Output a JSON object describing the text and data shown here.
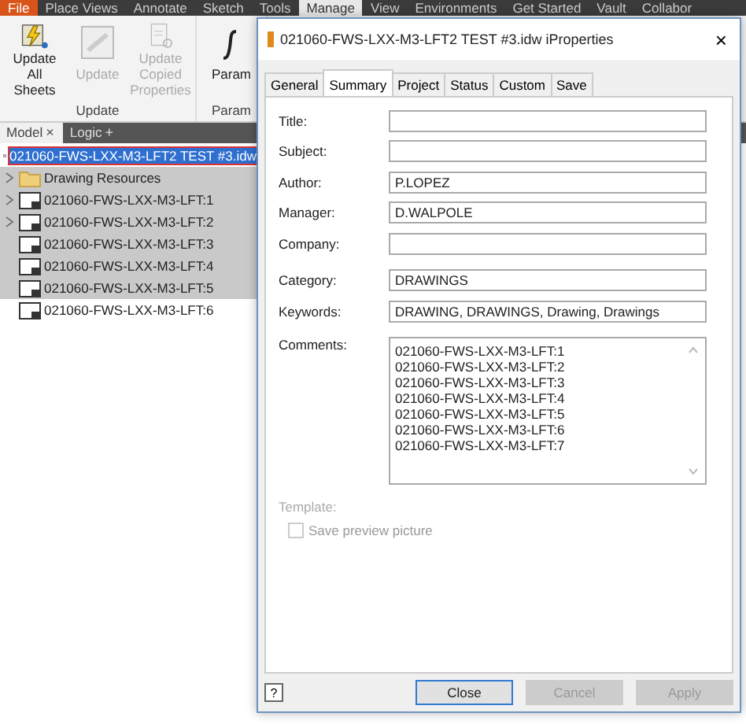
{
  "ribbon_tabs": [
    {
      "label": "File",
      "kind": "file",
      "selected": false
    },
    {
      "label": "Place Views",
      "kind": "tab",
      "selected": false
    },
    {
      "label": "Annotate",
      "kind": "tab",
      "selected": false
    },
    {
      "label": "Sketch",
      "kind": "tab",
      "selected": false
    },
    {
      "label": "Tools",
      "kind": "tab",
      "selected": false
    },
    {
      "label": "Manage",
      "kind": "tab",
      "selected": true
    },
    {
      "label": "View",
      "kind": "tab",
      "selected": false
    },
    {
      "label": "Environments",
      "kind": "tab",
      "selected": false
    },
    {
      "label": "Get Started",
      "kind": "tab",
      "selected": false
    },
    {
      "label": "Vault",
      "kind": "tab",
      "selected": false
    },
    {
      "label": "Collabor",
      "kind": "tab",
      "selected": false
    }
  ],
  "ribbon_panels": [
    {
      "title": "Update",
      "buttons": [
        {
          "label": "Update All Sheets",
          "disabled": false,
          "kind": "update-all"
        },
        {
          "label": "Update",
          "disabled": true,
          "kind": "update"
        },
        {
          "label": "Update Copied Properties",
          "disabled": true,
          "kind": "copied"
        }
      ]
    },
    {
      "title": "Param",
      "buttons": [
        {
          "label": "Param",
          "disabled": false,
          "kind": "param"
        }
      ]
    }
  ],
  "browser_tabs": [
    {
      "label": "Model",
      "selected": true,
      "action": "×"
    },
    {
      "label": "Logic",
      "selected": false,
      "action": "+"
    }
  ],
  "tree": {
    "label": "021060-FWS-LXX-M3-LFT2 TEST  #3.idw",
    "selected": true,
    "children": [
      {
        "label": "Drawing Resources",
        "kind": "folder",
        "highlighted": true,
        "expandable": true
      },
      {
        "label": "021060-FWS-LXX-M3-LFT:1",
        "kind": "sheet",
        "highlighted": true,
        "expandable": true
      },
      {
        "label": "021060-FWS-LXX-M3-LFT:2",
        "kind": "sheet",
        "highlighted": true,
        "expandable": true
      },
      {
        "label": "021060-FWS-LXX-M3-LFT:3",
        "kind": "sheet",
        "highlighted": true,
        "expandable": false
      },
      {
        "label": "021060-FWS-LXX-M3-LFT:4",
        "kind": "sheet",
        "highlighted": true,
        "expandable": false
      },
      {
        "label": "021060-FWS-LXX-M3-LFT:5",
        "kind": "sheet",
        "highlighted": true,
        "expandable": false
      },
      {
        "label": "021060-FWS-LXX-M3-LFT:6",
        "kind": "sheet",
        "highlighted": false,
        "expandable": false
      }
    ]
  },
  "dialog": {
    "title": "021060-FWS-LXX-M3-LFT2 TEST #3.idw iProperties",
    "close": "×",
    "tabs": [
      {
        "label": "General",
        "selected": false
      },
      {
        "label": "Summary",
        "selected": true
      },
      {
        "label": "Project",
        "selected": false
      },
      {
        "label": "Status",
        "selected": false
      },
      {
        "label": "Custom",
        "selected": false
      },
      {
        "label": "Save",
        "selected": false
      }
    ],
    "field_groups": [
      [
        {
          "label": "Title:"
        },
        {
          "label": "Subject:"
        },
        {
          "label": "Author:",
          "value": "P.LOPEZ"
        },
        {
          "label": "Manager:",
          "value": "D.WALPOLE"
        },
        {
          "label": "Company:"
        }
      ],
      [
        {
          "label": "Category:",
          "value": "DRAWINGS"
        },
        {
          "label": "Keywords:",
          "value": "DRAWING, DRAWINGS, Drawing, Drawings"
        }
      ]
    ],
    "comments": {
      "label": "Comments:",
      "lines": [
        "021060-FWS-LXX-M3-LFT:1",
        "021060-FWS-LXX-M3-LFT:2",
        "021060-FWS-LXX-M3-LFT:3",
        "021060-FWS-LXX-M3-LFT:4",
        "021060-FWS-LXX-M3-LFT:5",
        "021060-FWS-LXX-M3-LFT:6",
        "021060-FWS-LXX-M3-LFT:7"
      ]
    },
    "template": {
      "label": "Template:",
      "disabled": true
    },
    "save_preview": {
      "label": "Save preview picture",
      "checked": false,
      "disabled": true
    },
    "help": "?",
    "buttons": [
      {
        "label": "Close",
        "disabled": false,
        "default": true
      },
      {
        "label": "Cancel",
        "disabled": true,
        "default": false
      },
      {
        "label": "Apply",
        "disabled": true,
        "default": false
      }
    ]
  }
}
